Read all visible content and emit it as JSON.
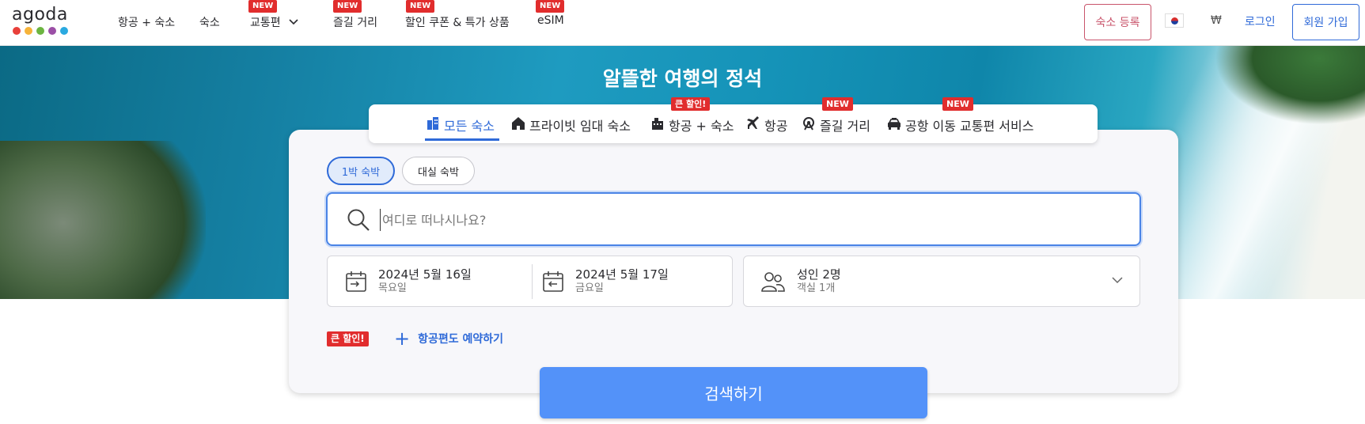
{
  "brand": {
    "name": "agoda",
    "dot_colors": [
      "#e8403a",
      "#f6b33a",
      "#6cb541",
      "#9b4fa6",
      "#2aa9e0"
    ]
  },
  "nav": {
    "items": [
      {
        "label": "항공 + 숙소",
        "badge": ""
      },
      {
        "label": "숙소",
        "badge": ""
      },
      {
        "label": "교통편",
        "badge": "NEW"
      },
      {
        "label": "즐길 거리",
        "badge": "NEW"
      },
      {
        "label": "할인 쿠폰 & 특가 상품",
        "badge": "NEW"
      },
      {
        "label": "eSIM",
        "badge": "NEW"
      }
    ],
    "register_label": "숙소 등록",
    "currency": "₩",
    "login_label": "로그인",
    "signup_label": "회원 가입"
  },
  "hero": {
    "title": "알뜰한 여행의 정석"
  },
  "tabs": [
    {
      "label": "모든 숙소",
      "badge": "",
      "active": true
    },
    {
      "label": "프라이빗 임대 숙소",
      "badge": ""
    },
    {
      "label": "항공 + 숙소",
      "badge": "큰 할인!"
    },
    {
      "label": "항공",
      "badge": ""
    },
    {
      "label": "즐길 거리",
      "badge": "NEW"
    },
    {
      "label": "공항 이동 교통편 서비스",
      "badge": "NEW"
    }
  ],
  "search": {
    "stay_options": [
      "1박 숙박",
      "대실 숙박"
    ],
    "placeholder": "여디로 떠나시나요?",
    "checkin": {
      "date": "2024년 5월 16일",
      "weekday": "목요일"
    },
    "checkout": {
      "date": "2024년 5월 17일",
      "weekday": "금요일"
    },
    "guests": {
      "adults": "성인 2명",
      "rooms": "객실 1개"
    },
    "promo_badge": "큰 할인!",
    "add_flight_label": "항공편도 예약하기",
    "submit_label": "검색하기"
  },
  "colors": {
    "accent": "#2f6ad8",
    "button": "#5392f9",
    "badge_red": "#e12d2d",
    "register_pink": "#c9546b"
  }
}
